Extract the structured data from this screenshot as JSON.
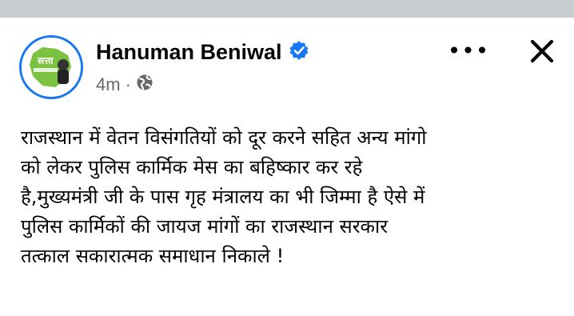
{
  "post": {
    "author": "Hanuman Beniwal",
    "verified_icon": "verified-badge-icon",
    "time": "4m",
    "separator": "·",
    "audience_icon": "globe-icon",
    "avatar_text": "सत्ता",
    "lines": [
      "राजस्थान में वेतन विसंगतियों को दूर करने सहित अन्य मांगो",
      "को लेकर पुलिस कार्मिक मेस का बहिष्कार कर रहे",
      "है,मुख्यमंत्री जी के पास गृह मंत्रालय का भी जिम्मा है ऐसे में",
      "पुलिस कार्मिकों की जायज मांगों का राजस्थान सरकार",
      "तत्काल सकारात्मक समाधान निकाले !"
    ]
  },
  "header": {
    "more_icon": "more-options-icon",
    "more_label": "•••",
    "close_icon": "close-icon"
  },
  "colors": {
    "accent": "#1877f2",
    "text": "#050505",
    "muted": "#65676b",
    "top_strip": "#c9ccd1",
    "avatar_green": "#7cc242"
  }
}
